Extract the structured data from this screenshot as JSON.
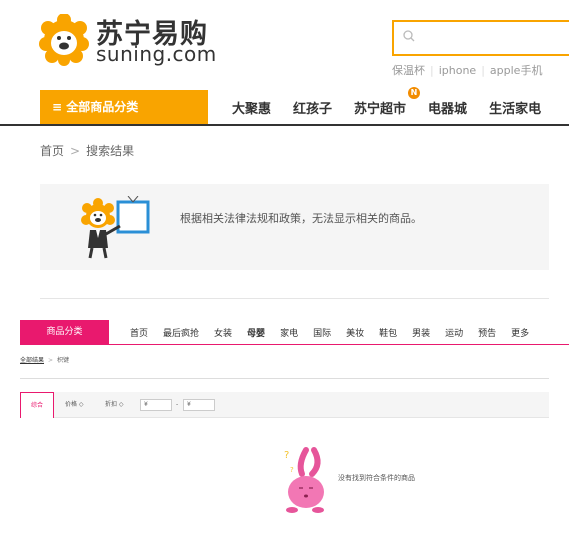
{
  "header": {
    "logo_cn": "苏宁易购",
    "logo_en": "suning.com",
    "search": {
      "placeholder": ""
    },
    "hot_words": [
      "保温杯",
      "iphone",
      "apple手机"
    ],
    "category_button": "≡ 全部商品分类",
    "nav": [
      {
        "label": "大聚惠"
      },
      {
        "label": "红孩子"
      },
      {
        "label": "苏宁超市",
        "badge": "N"
      },
      {
        "label": "电器城"
      },
      {
        "label": "生活家电"
      }
    ]
  },
  "breadcrumb": {
    "home": "首页",
    "current": "搜索结果"
  },
  "notice": {
    "text": "根据相关法律法规和政策，无法显示相关的商品。"
  },
  "lower": {
    "category_button": "商品分类",
    "nav": [
      {
        "label": "首页",
        "bold": false
      },
      {
        "label": "最后疯抢",
        "bold": false
      },
      {
        "label": "女装",
        "bold": false
      },
      {
        "label": "母婴",
        "bold": true
      },
      {
        "label": "家电",
        "bold": false
      },
      {
        "label": "国际",
        "bold": false
      },
      {
        "label": "美妆",
        "bold": false
      },
      {
        "label": "鞋包",
        "bold": false
      },
      {
        "label": "男装",
        "bold": false
      },
      {
        "label": "运动",
        "bold": false
      },
      {
        "label": "预告",
        "bold": false
      },
      {
        "label": "更多",
        "bold": false
      }
    ],
    "breadcrumb": {
      "all": "全部结果",
      "keyword": "枳键"
    },
    "sort": {
      "comprehensive": "综合",
      "price": "价格 ◇",
      "discount": "折扣 ◇",
      "min_price": "¥",
      "separator": "-",
      "max_price": "¥"
    },
    "empty_message": "没有找到符合条件的商品"
  },
  "colors": {
    "suning_orange": "#f9a400",
    "pink": "#e9196e"
  }
}
